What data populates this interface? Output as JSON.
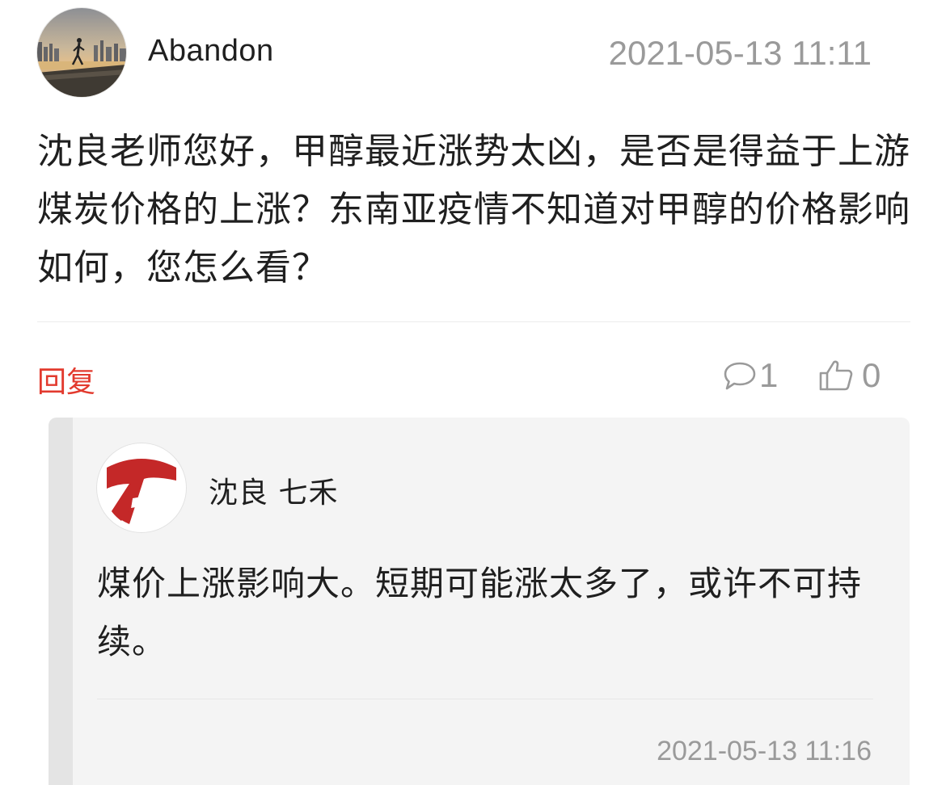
{
  "post": {
    "username": "Abandon",
    "time": "2021-05-13 11:11",
    "content": "沈良老师您好，甲醇最近涨势太凶，是否是得益于上游煤炭价格的上涨？东南亚疫情不知道对甲醇的价格影响如何，您怎么看？"
  },
  "actions": {
    "reply_label": "回复",
    "comment_count": "1",
    "like_count": "0",
    "comment_icon": "speech-bubble-icon",
    "like_icon": "thumbs-up-icon"
  },
  "reply": {
    "author": "沈良 七禾",
    "content": "煤价上涨影响大。短期可能涨太多了，或许不可持续。",
    "time": "2021-05-13 11:16"
  },
  "colors": {
    "accent_red": "#e23a2e",
    "muted_text": "#9a9a9a",
    "reply_bg": "#f4f4f4",
    "logo_red": "#c42828"
  }
}
